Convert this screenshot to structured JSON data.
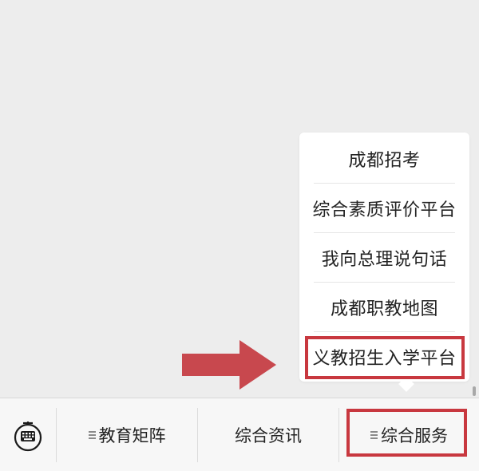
{
  "menu": {
    "items": [
      {
        "label": "成都招考"
      },
      {
        "label": "综合素质评价平台"
      },
      {
        "label": "我向总理说句话"
      },
      {
        "label": "成都职教地图"
      },
      {
        "label": "义教招生入学平台"
      }
    ]
  },
  "bottom_bar": {
    "keyboard_icon": "keyboard-icon",
    "tabs": [
      {
        "label": "教育矩阵",
        "has_menu_icon": true
      },
      {
        "label": "综合资讯",
        "has_menu_icon": false
      },
      {
        "label": "综合服务",
        "has_menu_icon": true
      }
    ]
  },
  "colors": {
    "highlight": "#c8383f",
    "background": "#ededed",
    "popup": "#ffffff"
  }
}
